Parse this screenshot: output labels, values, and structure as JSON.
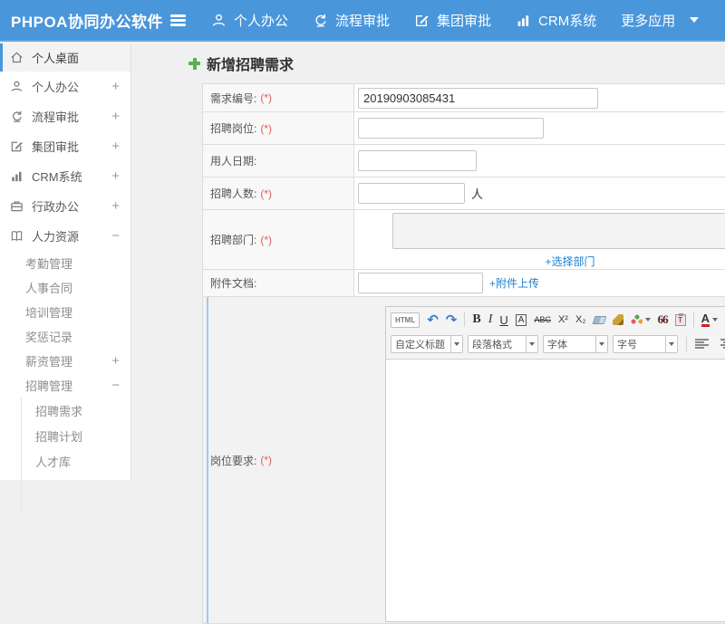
{
  "header": {
    "logo": "PHPOA协同办公软件",
    "nav": [
      {
        "label": "个人办公",
        "icon": "user-icon"
      },
      {
        "label": "流程审批",
        "icon": "process-icon"
      },
      {
        "label": "集团审批",
        "icon": "edit-icon"
      },
      {
        "label": "CRM系统",
        "icon": "chart-icon"
      },
      {
        "label": "更多应用",
        "icon": "caret-down-icon"
      }
    ]
  },
  "sidebar": {
    "items": [
      {
        "label": "个人桌面",
        "icon": "home-icon",
        "active": true
      },
      {
        "label": "个人办公",
        "icon": "user-icon",
        "toggle": "+"
      },
      {
        "label": "流程审批",
        "icon": "process-icon",
        "toggle": "+"
      },
      {
        "label": "集团审批",
        "icon": "edit-icon",
        "toggle": "+"
      },
      {
        "label": "CRM系统",
        "icon": "chart-icon",
        "toggle": "+"
      },
      {
        "label": "行政办公",
        "icon": "briefcase-icon",
        "toggle": "+"
      },
      {
        "label": "人力资源",
        "icon": "book-icon",
        "toggle": "−"
      }
    ],
    "hr_children": [
      {
        "label": "考勤管理"
      },
      {
        "label": "人事合同"
      },
      {
        "label": "培训管理"
      },
      {
        "label": "奖惩记录"
      },
      {
        "label": "薪资管理",
        "toggle": "+"
      },
      {
        "label": "招聘管理",
        "toggle": "−"
      }
    ],
    "recruit_children": [
      {
        "label": "招聘需求"
      },
      {
        "label": "招聘计划"
      },
      {
        "label": "人才库"
      }
    ]
  },
  "main": {
    "page_title": "新增招聘需求",
    "form": {
      "rows": [
        {
          "label": "需求编号:",
          "required": "(*)",
          "value": "20190903085431"
        },
        {
          "label": "招聘岗位:",
          "required": "(*)",
          "value": ""
        },
        {
          "label": "用人日期:",
          "value": ""
        },
        {
          "label": "招聘人数:",
          "required": "(*)",
          "value": "",
          "suffix": "人"
        },
        {
          "label": "招聘部门:",
          "required": "(*)",
          "link": "+选择部门"
        },
        {
          "label": "附件文档:",
          "value": "",
          "link": "+附件上传"
        },
        {
          "label": "岗位要求:",
          "required": "(*)"
        }
      ]
    },
    "editor": {
      "source_button": "HTML",
      "icons": {
        "undo": "↶",
        "redo": "↷",
        "bold": "B",
        "italic": "I",
        "underline": "U",
        "border_a": "A",
        "strike": "ABC",
        "superscript": "X²",
        "subscript": "X₂",
        "quote": "66",
        "paste_t": "T",
        "fontcolor": "A"
      },
      "dropdowns": [
        {
          "label": "自定义标题"
        },
        {
          "label": "段落格式"
        },
        {
          "label": "字体"
        },
        {
          "label": "字号"
        }
      ]
    }
  },
  "colors": {
    "header_blue": "#4a96db",
    "link_blue": "#1b7fd0",
    "required_red": "#e05b5b",
    "accent_green": "#55b24a"
  }
}
